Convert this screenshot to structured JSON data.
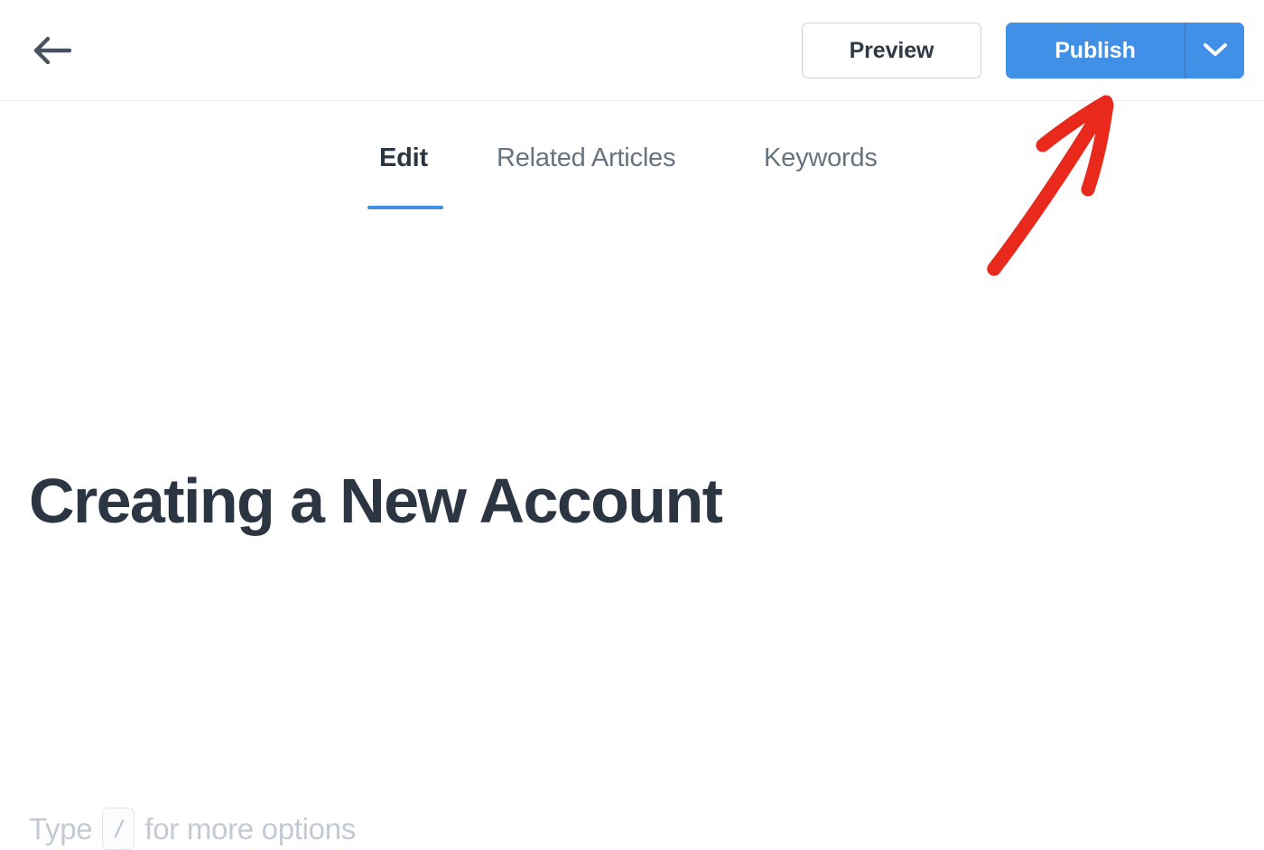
{
  "header": {
    "back_icon": "arrow-left-icon",
    "preview_label": "Preview",
    "publish_label": "Publish",
    "publish_dropdown_icon": "chevron-down-icon",
    "accent_color": "#4190e8",
    "border_color": "#c9d2dc"
  },
  "tabs": {
    "items": [
      {
        "label": "Edit",
        "active": true
      },
      {
        "label": "Related Articles",
        "active": false
      },
      {
        "label": "Keywords",
        "active": false
      }
    ],
    "active_indicator_color": "#4190e8",
    "active_text_color": "#2c3642",
    "inactive_text_color": "#67737f"
  },
  "editor": {
    "title": "Creating a New Account",
    "title_color": "#2c3642",
    "placeholder_prefix": "Type",
    "placeholder_key": "/",
    "placeholder_suffix": "for more options",
    "placeholder_color": "#c3cad3"
  },
  "annotation": {
    "type": "arrow",
    "direction": "up-right",
    "color": "#e8291c",
    "points_to": "Publish"
  }
}
